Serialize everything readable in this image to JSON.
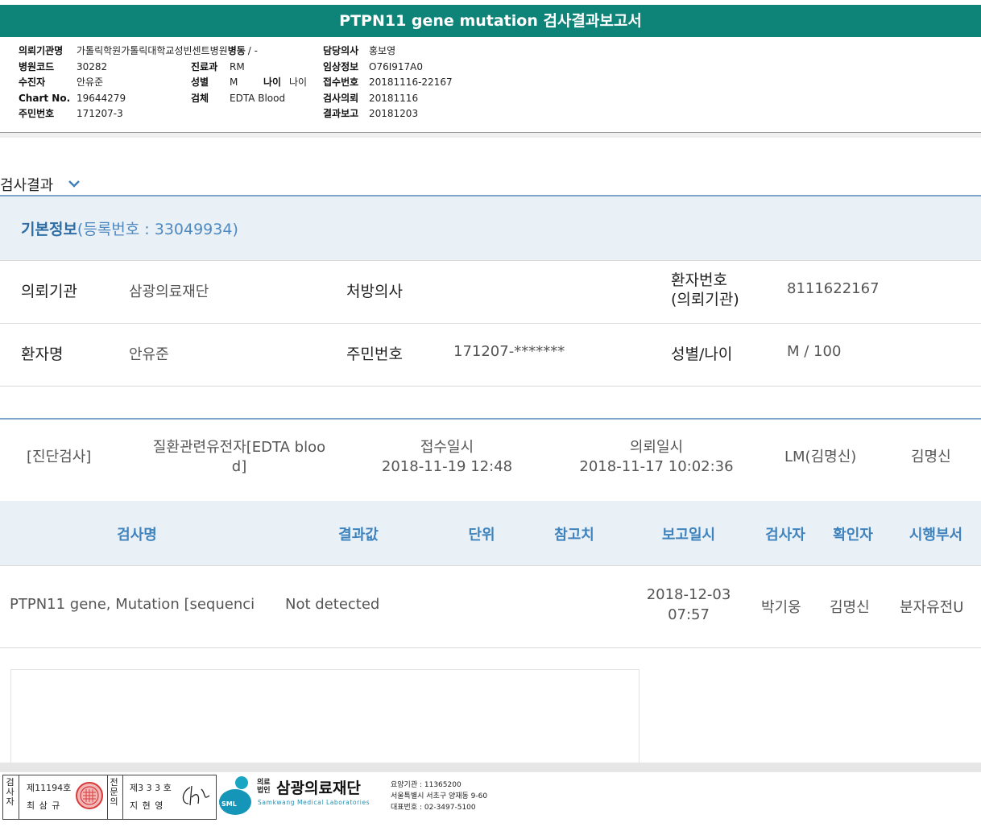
{
  "report_title": "PTPN11 gene mutation 검사결과보고서",
  "header": {
    "col1": [
      {
        "label": "의뢰기관명",
        "value": "가톨릭학원가톨릭대학교성빈센트병원"
      },
      {
        "label": "병원코드",
        "value": "30282"
      },
      {
        "label": "수진자",
        "value": "안유준"
      },
      {
        "label": "Chart No.",
        "value": "19644279"
      },
      {
        "label": "주민번호",
        "value": "171207-3"
      }
    ],
    "ward": {
      "label": "병동",
      "value": "/ -"
    },
    "col2": [
      {
        "label": "진료과",
        "value": "RM"
      },
      {
        "label": "성별",
        "value": "M"
      },
      {
        "label": "검체",
        "value": "EDTA Blood"
      }
    ],
    "age": {
      "label": "나이",
      "value": "나이"
    },
    "col3": [
      {
        "label": "담당의사",
        "value": "홍보영"
      },
      {
        "label": "임상정보",
        "value": "O76I917A0"
      },
      {
        "label": "접수번호",
        "value": "20181116-22167"
      },
      {
        "label": "검사의뢰",
        "value": "20181116"
      },
      {
        "label": "결과보고",
        "value": "20181203"
      }
    ]
  },
  "section_title": "검사결과",
  "icons": {
    "section_toggle": "chevron-down-icon",
    "stamp": "seal-stamp-icon",
    "signature": "signature-icon",
    "logo": "sml-logo-icon"
  },
  "basic_info": {
    "title": "기본정보",
    "reg_text": "(등록번호 : 33049934)",
    "requesting_org_label": "의뢰기관",
    "requesting_org_value": "삼광의료재단",
    "prescriber_label": "처방의사",
    "prescriber_value": "",
    "patient_no_label_1": "환자번호",
    "patient_no_label_2": "(의뢰기관)",
    "patient_no_value": "8111622167",
    "patient_name_label": "환자명",
    "patient_name_value": "안유준",
    "rrn_label": "주민번호",
    "rrn_value": "171207-*******",
    "sex_age_label": "성별/나이",
    "sex_age_value": "M / 100"
  },
  "diagnosis": {
    "category": "[진단검사]",
    "test_group_1": "질환관련유전자[EDTA bloo",
    "test_group_2": "d]",
    "received_label": "접수일시",
    "received_value": "2018-11-19 12:48",
    "requested_label": "의뢰일시",
    "requested_value": "2018-11-17 10:02:36",
    "lab": "LM(김명신)",
    "doctor": "김명신"
  },
  "results_table": {
    "headers": [
      "검사명",
      "결과값",
      "단위",
      "참고치",
      "보고일시",
      "검사자",
      "확인자",
      "시행부서"
    ],
    "rows": [
      {
        "test_name": "PTPN11 gene, Mutation [sequenci",
        "result": "Not detected",
        "unit": "",
        "reference": "",
        "report_date": "2018-12-03",
        "report_time": "07:57",
        "tester": "박기웅",
        "verifier": "김명신",
        "department": "분자유전U"
      }
    ]
  },
  "footer": {
    "tester_vertical": "검사자",
    "tester_license": "제11194호",
    "tester_name": "최 삼 규",
    "specialist_vertical": "전문의",
    "specialist_license": "제3 3 3 호",
    "specialist_name": "지 현 영",
    "org_small_1": "의료",
    "org_small_2": "법인",
    "org_name": "삼광의료재단",
    "org_english": "Samkwang Medical Laboratories",
    "logo_text": "SML",
    "care_code": "요양기관 : 11365200",
    "address": "서울특별시 서초구 양재동 9-60",
    "phone": "대표번호 : 02-3497-5100"
  }
}
